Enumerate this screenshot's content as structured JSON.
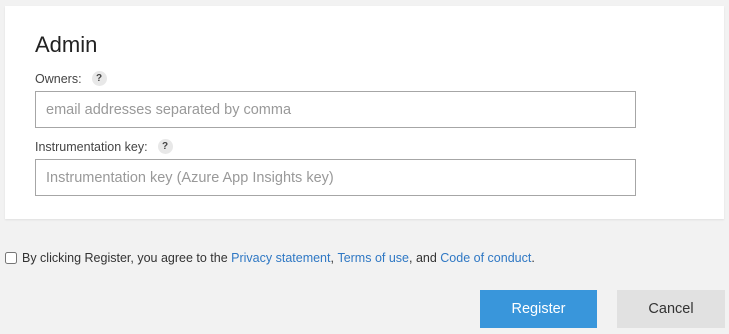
{
  "admin": {
    "title": "Admin",
    "owners_label": "Owners:",
    "owners_placeholder": "email addresses separated by comma",
    "owners_value": "",
    "ikey_label": "Instrumentation key:",
    "ikey_placeholder": "Instrumentation key (Azure App Insights key)",
    "ikey_value": "",
    "help_glyph": "?"
  },
  "agreement": {
    "checked": false,
    "text_prefix": "By clicking Register, you agree to the ",
    "privacy_link": "Privacy statement",
    "sep1": ", ",
    "terms_link": "Terms of use",
    "sep2": ", and ",
    "conduct_link": "Code of conduct",
    "suffix": "."
  },
  "actions": {
    "register_label": "Register",
    "cancel_label": "Cancel"
  },
  "colors": {
    "accent": "#3996db",
    "link": "#2f78c4",
    "background": "#f2f2f2",
    "cancel_bg": "#e1e1e1"
  },
  "icons": {
    "help": "help-icon",
    "checkbox": "checkbox"
  }
}
